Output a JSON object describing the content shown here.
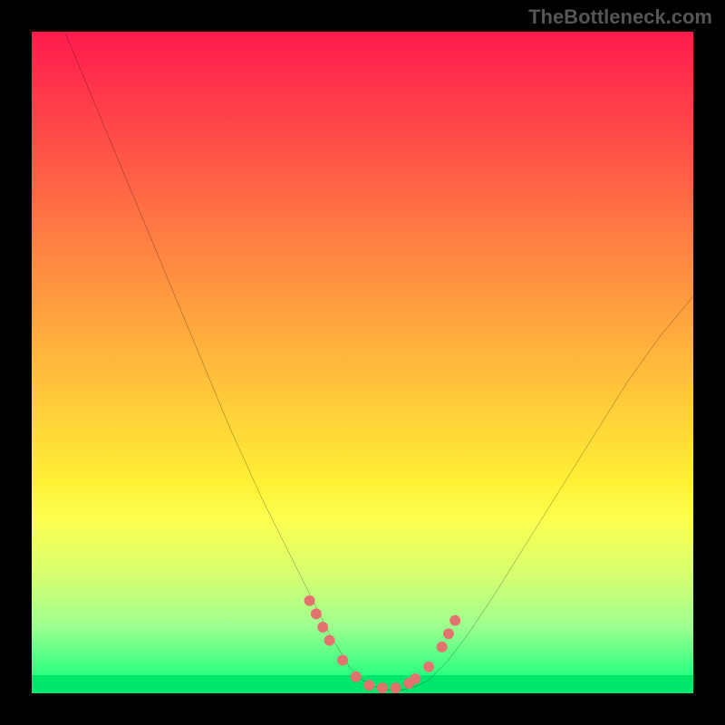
{
  "watermark": "TheBottleneck.com",
  "chart_data": {
    "type": "line",
    "title": "",
    "xlabel": "",
    "ylabel": "",
    "xlim": [
      0,
      100
    ],
    "ylim": [
      0,
      100
    ],
    "grid": false,
    "series": [
      {
        "name": "bottleneck-curve",
        "x": [
          5,
          10,
          15,
          20,
          25,
          30,
          35,
          40,
          45,
          48,
          50,
          52,
          54,
          56,
          58,
          60,
          63,
          66,
          70,
          75,
          80,
          85,
          90,
          95,
          100
        ],
        "values": [
          100,
          88,
          76,
          64,
          52,
          40,
          29,
          19,
          9,
          4,
          2,
          1,
          0.5,
          0.5,
          1,
          2,
          5,
          9,
          15,
          23,
          31,
          39,
          47,
          54,
          60
        ]
      }
    ],
    "markers": {
      "name": "highlight-dots",
      "x": [
        42,
        43,
        44,
        45,
        47,
        49,
        51,
        53,
        55,
        57,
        58,
        60,
        62,
        63,
        64
      ],
      "values": [
        14,
        12,
        10,
        8,
        5,
        2.5,
        1.2,
        0.8,
        0.8,
        1.5,
        2.2,
        4,
        7,
        9,
        11
      ],
      "color": "#e3736f",
      "size": 12
    },
    "background_gradient": {
      "top": "#ff1a4d",
      "bottom": "#00ff7a",
      "meaning": "percent-bottleneck-scale"
    }
  }
}
